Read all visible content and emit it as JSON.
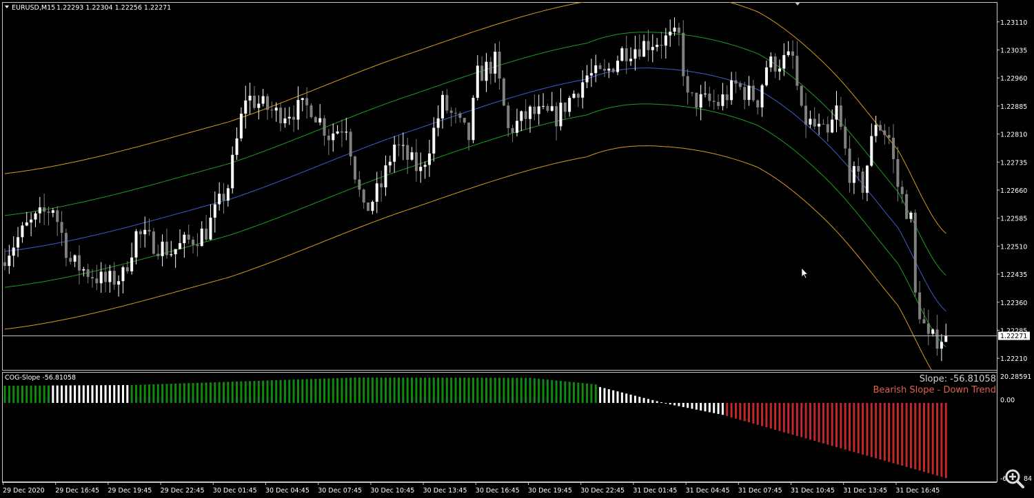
{
  "header": {
    "symbol_label": "EURUSD,M15",
    "ohlc": "1.22293 1.22304 1.22256 1.22271"
  },
  "indicator": {
    "title": "COG-Slope -56.81058",
    "slope_text": "Slope: -56.81058",
    "trend_text": "Bearish Slope - Down Trend",
    "axis_top": "20.28591",
    "axis_zero": "0.00",
    "axis_bottom_left": "-6",
    "axis_bottom_right": "84"
  },
  "colors": {
    "bull": "#ffffff",
    "bear": "#808080",
    "center": "#3a5fcd",
    "inner": "#1e9e1e",
    "outer": "#d99a1a",
    "hist_up": "#0f8a0f",
    "hist_flat": "#ffffff",
    "hist_down": "#c0282a",
    "trend_text": "#e0604e"
  },
  "chart_data": [
    {
      "type": "candlestick",
      "title": "EURUSD,M15",
      "candle_count": 216,
      "ylim": [
        1.22179,
        1.23163
      ],
      "y_ticks": [
        "1.23110",
        "1.23035",
        "1.22960",
        "1.22885",
        "1.22810",
        "1.22735",
        "1.22660",
        "1.22585",
        "1.22510",
        "1.22435",
        "1.22360",
        "1.22285",
        "1.22210"
      ],
      "current_price": "1.22271",
      "x_ticks": [
        "29 Dec 2020",
        "29 Dec 16:45",
        "29 Dec 19:45",
        "29 Dec 22:45",
        "30 Dec 01:45",
        "30 Dec 04:45",
        "30 Dec 07:45",
        "30 Dec 10:45",
        "30 Dec 13:45",
        "30 Dec 16:45",
        "30 Dec 19:45",
        "30 Dec 22:45",
        "31 Dec 01:45",
        "31 Dec 04:45",
        "31 Dec 07:45",
        "31 Dec 10:45",
        "31 Dec 13:45",
        "31 Dec 16:45"
      ],
      "x_tick_every_candles": 12,
      "close_keypoints": [
        [
          0,
          1.22487
        ],
        [
          5,
          1.22561
        ],
        [
          11,
          1.22616
        ],
        [
          15,
          1.22468
        ],
        [
          23,
          1.22413
        ],
        [
          27,
          1.22431
        ],
        [
          30,
          1.22542
        ],
        [
          38,
          1.22496
        ],
        [
          46,
          1.22551
        ],
        [
          51,
          1.22671
        ],
        [
          55,
          1.22911
        ],
        [
          62,
          1.22865
        ],
        [
          70,
          1.22883
        ],
        [
          74,
          1.22809
        ],
        [
          78,
          1.22837
        ],
        [
          80,
          1.22708
        ],
        [
          82,
          1.22597
        ],
        [
          86,
          1.22671
        ],
        [
          89,
          1.22782
        ],
        [
          95,
          1.22708
        ],
        [
          100,
          1.22892
        ],
        [
          106,
          1.228
        ],
        [
          108,
          1.22966
        ],
        [
          112,
          1.23003
        ],
        [
          115,
          1.22819
        ],
        [
          120,
          1.22865
        ],
        [
          126,
          1.22856
        ],
        [
          133,
          1.22966
        ],
        [
          137,
          1.22966
        ],
        [
          141,
          1.23031
        ],
        [
          148,
          1.23058
        ],
        [
          154,
          1.23068
        ],
        [
          156,
          1.22902
        ],
        [
          163,
          1.22892
        ],
        [
          167,
          1.22939
        ],
        [
          172,
          1.22902
        ],
        [
          174,
          1.22994
        ],
        [
          180,
          1.23012
        ],
        [
          182,
          1.22856
        ],
        [
          188,
          1.228
        ],
        [
          190,
          1.22874
        ],
        [
          193,
          1.22708
        ],
        [
          196,
          1.22671
        ],
        [
          199,
          1.22846
        ],
        [
          202,
          1.228
        ],
        [
          204,
          1.22671
        ],
        [
          207,
          1.22579
        ],
        [
          208,
          1.22376
        ],
        [
          211,
          1.22256
        ],
        [
          215,
          1.22271
        ]
      ],
      "channel": {
        "center_keypoints": [
          [
            0,
            1.22496
          ],
          [
            51,
            1.22634
          ],
          [
            93,
            1.22819
          ],
          [
            133,
            1.22957
          ],
          [
            150,
            1.22985
          ],
          [
            172,
            1.22929
          ],
          [
            188,
            1.22782
          ],
          [
            204,
            1.2256
          ],
          [
            215,
            1.22336
          ]
        ],
        "inner_offset": 0.00096,
        "outer_offset": 0.00208
      }
    },
    {
      "type": "bar",
      "title": "COG-Slope",
      "ylim": [
        -59.4,
        20.28591
      ],
      "bar_count": 216,
      "segments": [
        {
          "from": 0,
          "to": 10,
          "start": 13.0,
          "end": 13.2,
          "color": "hist_up"
        },
        {
          "from": 11,
          "to": 28,
          "start": 13.2,
          "end": 13.5,
          "color": "hist_flat"
        },
        {
          "from": 29,
          "to": 80,
          "start": 13.5,
          "end": 19.2,
          "color": "hist_up"
        },
        {
          "from": 81,
          "to": 120,
          "start": 19.2,
          "end": 19.0,
          "color": "hist_up"
        },
        {
          "from": 121,
          "to": 135,
          "start": 18.6,
          "end": 14.0,
          "color": "hist_up"
        },
        {
          "from": 136,
          "to": 150,
          "start": 12.0,
          "end": 0.5,
          "color": "hist_flat"
        },
        {
          "from": 151,
          "to": 164,
          "start": -0.5,
          "end": -9.0,
          "color": "hist_flat"
        },
        {
          "from": 165,
          "to": 215,
          "start": -10.0,
          "end": -56.81058,
          "color": "hist_down"
        }
      ],
      "last_value": -56.81058
    }
  ]
}
